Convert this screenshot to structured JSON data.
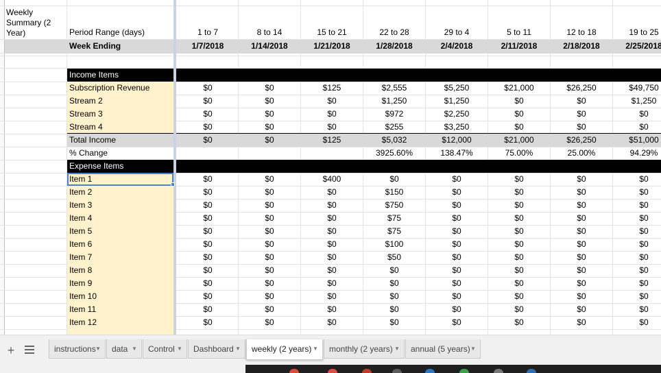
{
  "sheet": {
    "title": "Weekly Summary (2 Year)",
    "period_label": "Period Range (days)",
    "week_label": "Week Ending",
    "income_header": "Income Items",
    "expense_header": "Expense Items",
    "columns": [
      {
        "range": "1 to 7",
        "week": "1/7/2018"
      },
      {
        "range": "8 to 14",
        "week": "1/14/2018"
      },
      {
        "range": "15 to 21",
        "week": "1/21/2018"
      },
      {
        "range": "22 to 28",
        "week": "1/28/2018"
      },
      {
        "range": "29 to 4",
        "week": "2/4/2018"
      },
      {
        "range": "5 to 11",
        "week": "2/11/2018"
      },
      {
        "range": "12 to 18",
        "week": "2/18/2018"
      },
      {
        "range": "19 to 25",
        "week": "2/25/2018"
      }
    ],
    "income_rows": [
      {
        "label": "Subscription Revenue",
        "values": [
          "$0",
          "$0",
          "$125",
          "$2,555",
          "$5,250",
          "$21,000",
          "$26,250",
          "$49,750"
        ]
      },
      {
        "label": "Stream 2",
        "values": [
          "$0",
          "$0",
          "$0",
          "$1,250",
          "$1,250",
          "$0",
          "$0",
          "$1,250"
        ]
      },
      {
        "label": "Stream 3",
        "values": [
          "$0",
          "$0",
          "$0",
          "$972",
          "$2,250",
          "$0",
          "$0",
          "$0"
        ]
      },
      {
        "label": "Stream 4",
        "values": [
          "$0",
          "$0",
          "$0",
          "$255",
          "$3,250",
          "$0",
          "$0",
          "$0"
        ]
      }
    ],
    "total_row": {
      "label": "Total Income",
      "values": [
        "$0",
        "$0",
        "$125",
        "$5,032",
        "$12,000",
        "$21,000",
        "$26,250",
        "$51,000"
      ]
    },
    "change_row": {
      "label": "% Change",
      "values": [
        "",
        "",
        "",
        "3925.60%",
        "138.47%",
        "75.00%",
        "25.00%",
        "94.29%"
      ]
    },
    "expense_rows": [
      {
        "label": "Item 1",
        "values": [
          "$0",
          "$0",
          "$400",
          "$0",
          "$0",
          "$0",
          "$0",
          "$0"
        ]
      },
      {
        "label": "Item 2",
        "values": [
          "$0",
          "$0",
          "$0",
          "$150",
          "$0",
          "$0",
          "$0",
          "$0"
        ]
      },
      {
        "label": "Item 3",
        "values": [
          "$0",
          "$0",
          "$0",
          "$750",
          "$0",
          "$0",
          "$0",
          "$0"
        ]
      },
      {
        "label": "Item 4",
        "values": [
          "$0",
          "$0",
          "$0",
          "$75",
          "$0",
          "$0",
          "$0",
          "$0"
        ]
      },
      {
        "label": "Item 5",
        "values": [
          "$0",
          "$0",
          "$0",
          "$75",
          "$0",
          "$0",
          "$0",
          "$0"
        ]
      },
      {
        "label": "Item 6",
        "values": [
          "$0",
          "$0",
          "$0",
          "$100",
          "$0",
          "$0",
          "$0",
          "$0"
        ]
      },
      {
        "label": "Item 7",
        "values": [
          "$0",
          "$0",
          "$0",
          "$50",
          "$0",
          "$0",
          "$0",
          "$0"
        ]
      },
      {
        "label": "Item 8",
        "values": [
          "$0",
          "$0",
          "$0",
          "$0",
          "$0",
          "$0",
          "$0",
          "$0"
        ]
      },
      {
        "label": "Item 9",
        "values": [
          "$0",
          "$0",
          "$0",
          "$0",
          "$0",
          "$0",
          "$0",
          "$0"
        ]
      },
      {
        "label": "Item 10",
        "values": [
          "$0",
          "$0",
          "$0",
          "$0",
          "$0",
          "$0",
          "$0",
          "$0"
        ]
      },
      {
        "label": "Item 11",
        "values": [
          "$0",
          "$0",
          "$0",
          "$0",
          "$0",
          "$0",
          "$0",
          "$0"
        ]
      },
      {
        "label": "Item 12",
        "values": [
          "$0",
          "$0",
          "$0",
          "$0",
          "$0",
          "$0",
          "$0",
          "$0"
        ]
      }
    ]
  },
  "tabs": [
    {
      "label": "instructions",
      "active": false
    },
    {
      "label": "data",
      "active": false
    },
    {
      "label": "Control",
      "active": false
    },
    {
      "label": "Dashboard",
      "active": false
    },
    {
      "label": "weekly (2 years)",
      "active": true
    },
    {
      "label": "monthly (2 years)",
      "active": false
    },
    {
      "label": "annual (5 years)",
      "active": false
    }
  ],
  "toolbar": {
    "add_sheet_icon": "plus-icon",
    "all_sheets_icon": "menu-icon"
  },
  "colors": {
    "income_bg": "#fff2cc",
    "header_black": "#000000",
    "band_gray": "#d9d9d9",
    "selection": "#4a7fd4"
  }
}
